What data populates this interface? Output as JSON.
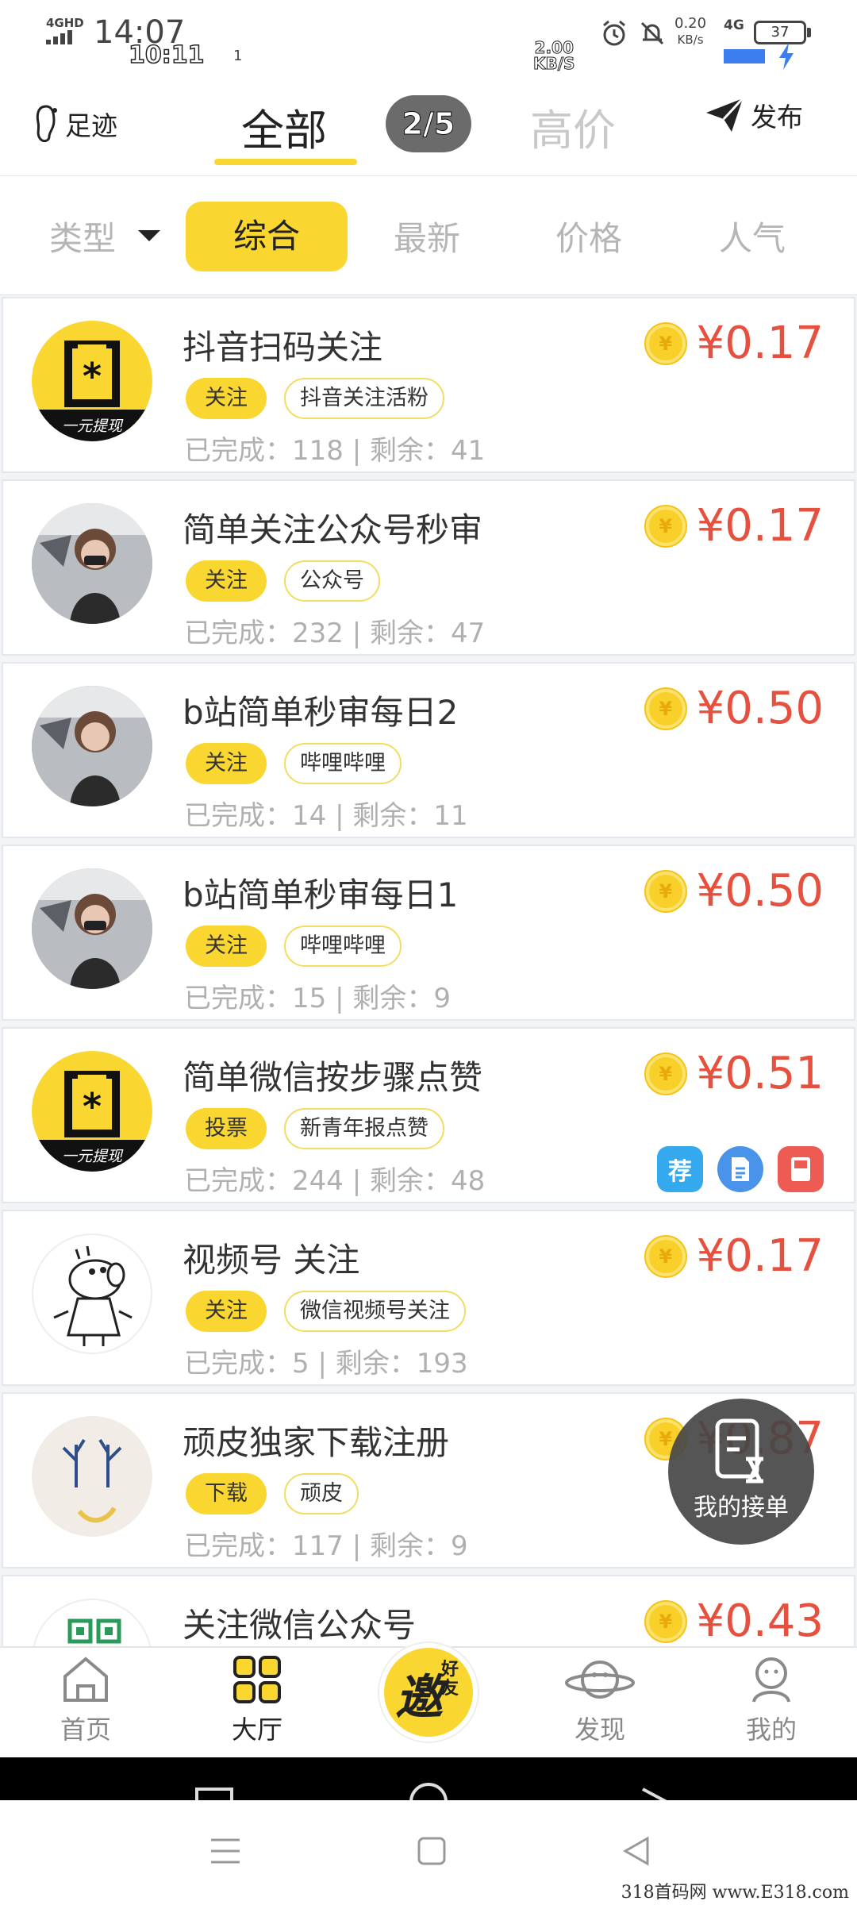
{
  "status_bar": {
    "network": "4GHD",
    "time": "14:07",
    "time_overlay": "10:11",
    "notif_count": "1",
    "speed_overlay_value": "2.00",
    "speed_overlay_unit": "KB/S",
    "speed_value": "0.20",
    "speed_unit": "KB/s",
    "cellular": "4G",
    "battery": "37"
  },
  "top_nav": {
    "left_label": "足迹",
    "tabs": [
      {
        "label": "全部",
        "active": true
      },
      {
        "label": "高价",
        "active": false
      }
    ],
    "page_badge": "2/5",
    "right_label": "发布"
  },
  "filter_bar": {
    "type_label": "类型",
    "items": [
      "综合",
      "最新",
      "价格",
      "人气"
    ],
    "active": "综合"
  },
  "tasks": [
    {
      "title": "抖音扫码关注",
      "tag": "关注",
      "subtag": "抖音关注活粉",
      "stats": "已完成：118 | 剩余：41",
      "price": "¥0.17",
      "avatar": "logo",
      "logo_text": "一元提现"
    },
    {
      "title": "简单关注公众号秒审",
      "tag": "关注",
      "subtag": "公众号",
      "stats": "已完成：232 | 剩余：47",
      "price": "¥0.17",
      "avatar": "photo"
    },
    {
      "title": "b站简单秒审每日2",
      "tag": "关注",
      "subtag": "哔哩哔哩",
      "stats": "已完成：14 | 剩余：11",
      "price": "¥0.50",
      "avatar": "photo"
    },
    {
      "title": "b站简单秒审每日1",
      "tag": "关注",
      "subtag": "哔哩哔哩",
      "stats": "已完成：15 | 剩余：9",
      "price": "¥0.50",
      "avatar": "photo"
    },
    {
      "title": "简单微信按步骤点赞",
      "tag": "投票",
      "subtag": "新青年报点赞",
      "stats": "已完成：244 | 剩余：48",
      "price": "¥0.51",
      "avatar": "logo",
      "logo_text": "一元提现",
      "badges": [
        "荐"
      ]
    },
    {
      "title": "视频号 关注",
      "tag": "关注",
      "subtag": "微信视频号关注",
      "stats": "已完成：5 | 剩余：193",
      "price": "¥0.17",
      "avatar": "pig"
    },
    {
      "title": "顽皮独家下载注册",
      "tag": "下载",
      "subtag": "顽皮",
      "stats": "已完成：117 | 剩余：9",
      "price": "¥0.87",
      "avatar": "deer"
    },
    {
      "title": "关注微信公众号",
      "tag": "",
      "subtag": "",
      "stats": "",
      "price": "¥0.43",
      "avatar": "qr"
    }
  ],
  "float_button": {
    "label": "我的接单"
  },
  "tab_bar": {
    "items": [
      {
        "label": "首页",
        "icon": "home-icon"
      },
      {
        "label": "大厅",
        "icon": "grid-icon",
        "active": true
      },
      {
        "label": "发现",
        "icon": "planet-icon"
      },
      {
        "label": "我的",
        "icon": "person-icon"
      }
    ],
    "invite_big": "邀",
    "invite_small_1": "好",
    "invite_small_2": "友"
  },
  "watermark": "318首码网 www.E318.com",
  "colors": {
    "accent": "#f9d730",
    "price": "#e6503e",
    "muted": "#b0b0b0"
  }
}
